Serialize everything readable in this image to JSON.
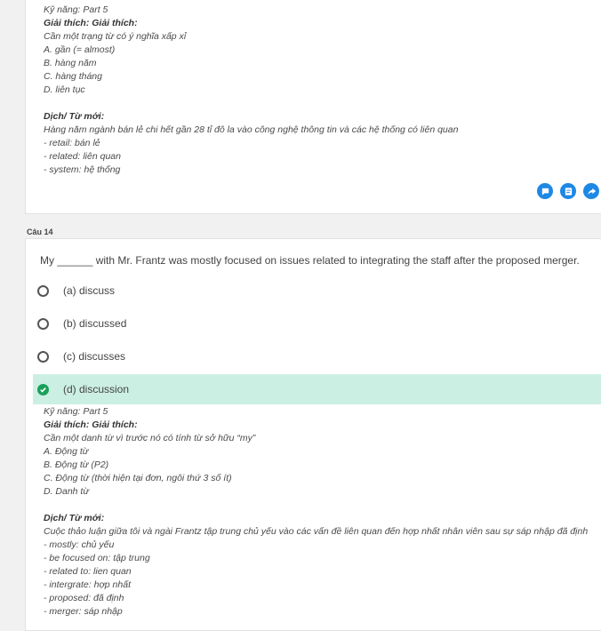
{
  "prev_card": {
    "skill": "Kỹ năng: Part 5",
    "explain_head": "Giải thích: Giải thích:",
    "explain_lines": [
      "Cần một trạng từ có ý nghĩa xấp xỉ",
      "A. gần (= almost)",
      "B. hàng năm",
      "C. hàng tháng",
      "D. liên tục"
    ],
    "translate_head": "Dịch/ Từ mới:",
    "translate_lines": [
      "Hàng năm ngành bán lẻ chi hết gần 28 tỉ đô la vào công nghệ thông tin và các hệ thống có liên quan",
      "- retail: bán lẻ",
      "- related: liên quan",
      "- system: hệ thống"
    ],
    "actions": [
      {
        "name": "comment-icon"
      },
      {
        "name": "note-icon"
      },
      {
        "name": "share-icon"
      }
    ]
  },
  "question": {
    "label": "Câu 14",
    "text": "My ______ with Mr. Frantz was mostly focused on issues related to integrating the staff after the proposed merger.",
    "options": [
      {
        "label": "(a) discuss",
        "correct": false
      },
      {
        "label": "(b) discussed",
        "correct": false
      },
      {
        "label": "(c) discusses",
        "correct": false
      },
      {
        "label": "(d) discussion",
        "correct": true
      }
    ],
    "skill": "Kỹ năng: Part 5",
    "explain_head": "Giải thích: Giải thích:",
    "explain_lines": [
      "Cần một danh từ vì trước nó có tính từ sở hữu “my”",
      "A. Động từ",
      "B. Động từ (P2)",
      "C. Động từ (thời hiện tại đơn, ngôi thứ 3 số ít)",
      "D. Danh từ"
    ],
    "translate_head": "Dịch/ Từ mới:",
    "translate_lines": [
      "Cuộc thảo luận giữa tôi và ngài Frantz tập trung chủ yếu vào các vấn đề liên quan đến hợp nhất nhân viên sau sự sáp nhập đã định",
      "- mostly: chủ yếu",
      "- be focused on: tập trung",
      "- related to: lien quan",
      "- intergrate: hợp nhất",
      "- proposed: đã định",
      "- merger: sáp nhập"
    ]
  },
  "colors": {
    "correct_bg": "#ccefe3",
    "check": "#1aa05a",
    "action": "#1e88e5"
  }
}
